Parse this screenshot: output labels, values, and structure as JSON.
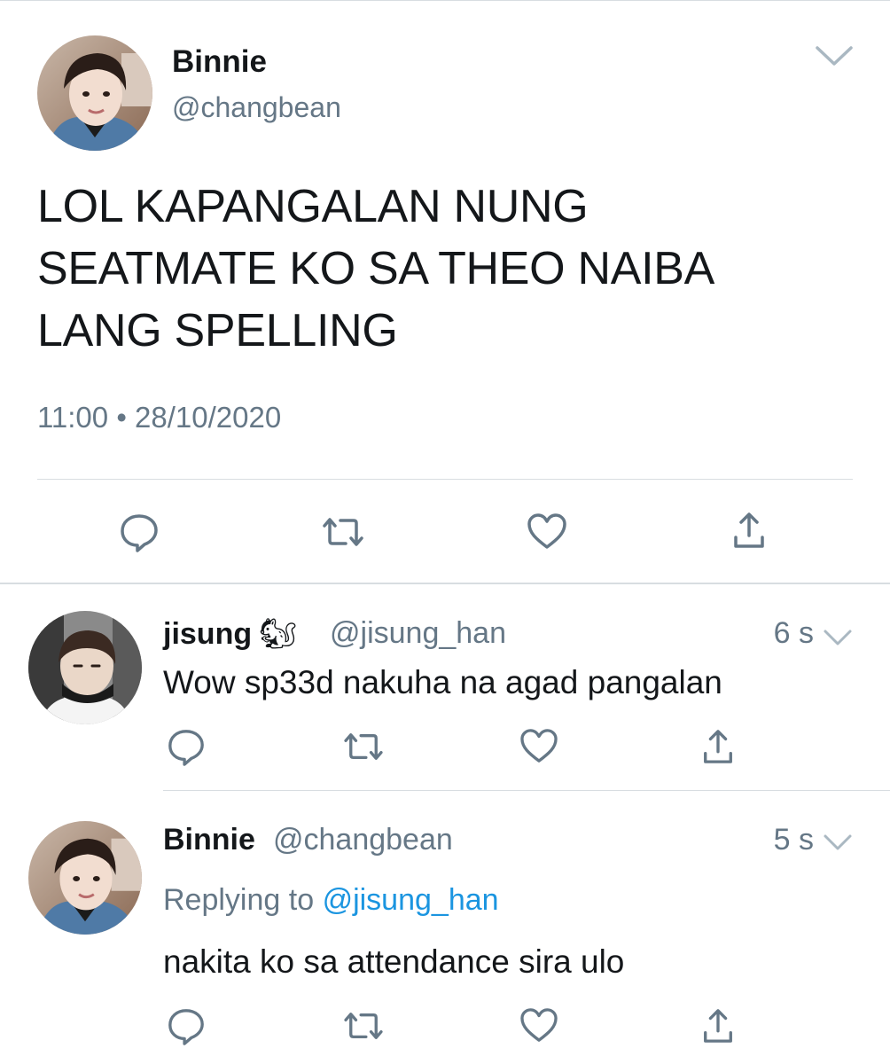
{
  "colors": {
    "text": "#14171a",
    "secondary": "#657786",
    "link": "#1b95e0",
    "divider": "#d8dde1",
    "icon": "#657786"
  },
  "main_tweet": {
    "author_name": "Binnie",
    "author_handle": "@changbean",
    "text_lines": [
      "LOL KAPANGALAN NUNG",
      "SEATMATE KO SA THEO NAIBA",
      "LANG SPELLING"
    ],
    "time": "11:00",
    "separator": "•",
    "date": "28/10/2020",
    "actions": [
      "reply-icon",
      "retweet-icon",
      "like-icon",
      "share-icon"
    ]
  },
  "replies": [
    {
      "author_name": "jisung",
      "author_emoji": "🐿",
      "author_handle": "@jisung_han",
      "time": "6 s",
      "text": "Wow sp33d nakuha na agad pangalan"
    },
    {
      "author_name": "Binnie",
      "author_handle": "@changbean",
      "time": "5 s",
      "replying_prefix": "Replying to",
      "replying_to": "@jisung_han",
      "text": "nakita ko sa attendance sira ulo"
    }
  ]
}
